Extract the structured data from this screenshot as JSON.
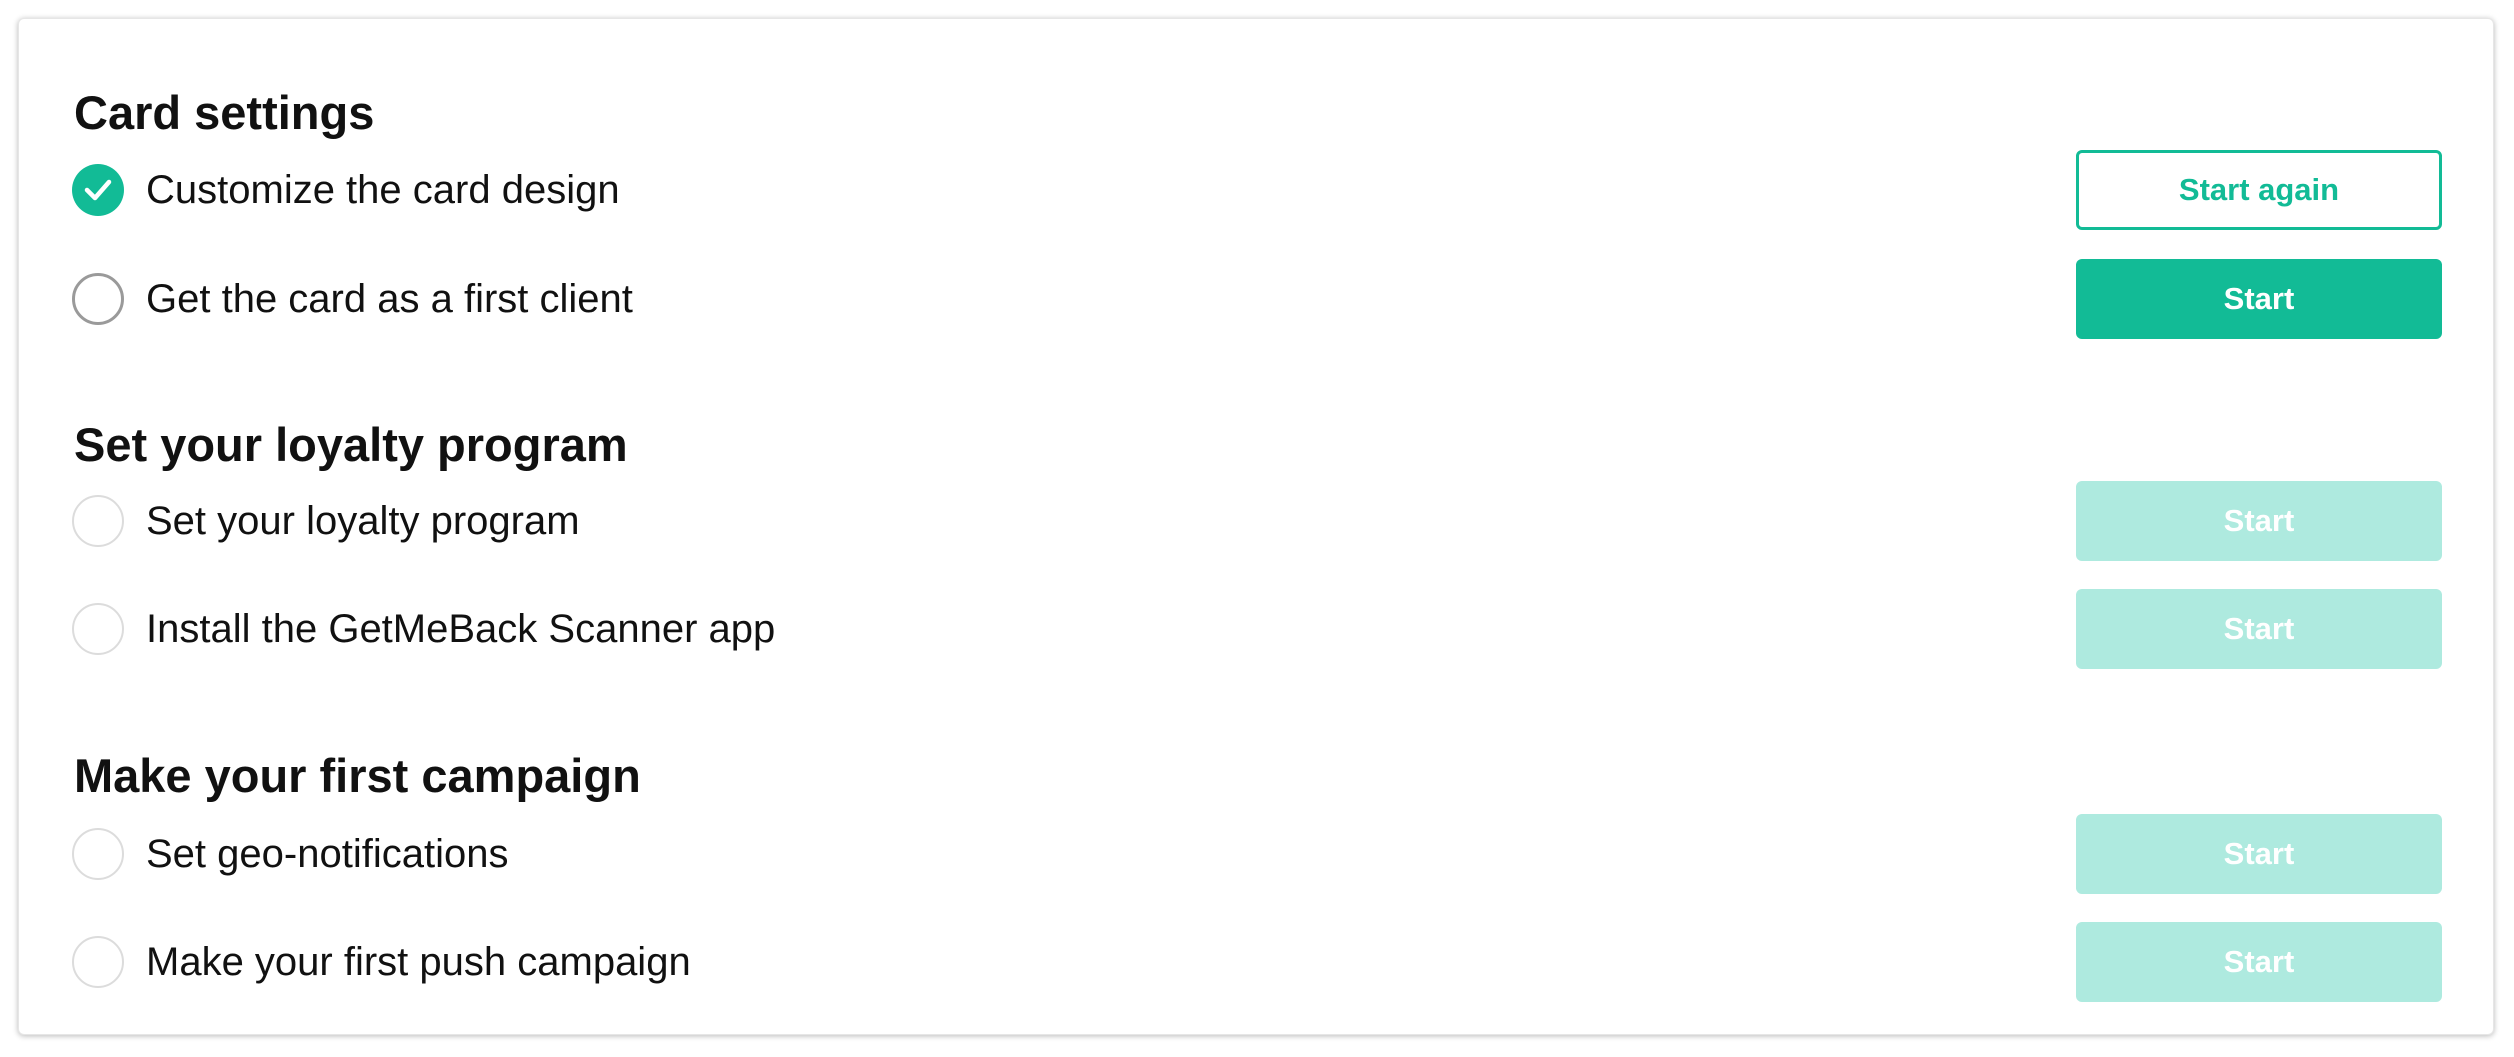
{
  "colors": {
    "accent": "#12bb96",
    "accent_disabled": "#aeeadf",
    "text": "#111111"
  },
  "sections": [
    {
      "title": "Card settings",
      "items": [
        {
          "label": "Customize the card design",
          "status": "done",
          "button": "Start again"
        },
        {
          "label": "Get the card as a first client",
          "status": "current",
          "button": "Start"
        }
      ]
    },
    {
      "title": "Set your loyalty program",
      "items": [
        {
          "label": "Set your loyalty program",
          "status": "locked",
          "button": "Start"
        },
        {
          "label": "Install the GetMeBack Scanner app",
          "status": "locked",
          "button": "Start"
        }
      ]
    },
    {
      "title": "Make your first campaign",
      "items": [
        {
          "label": "Set geo-notifications",
          "status": "locked",
          "button": "Start"
        },
        {
          "label": "Make your first push campaign",
          "status": "locked",
          "button": "Start"
        }
      ]
    }
  ],
  "icons": {
    "done": "check-icon"
  }
}
